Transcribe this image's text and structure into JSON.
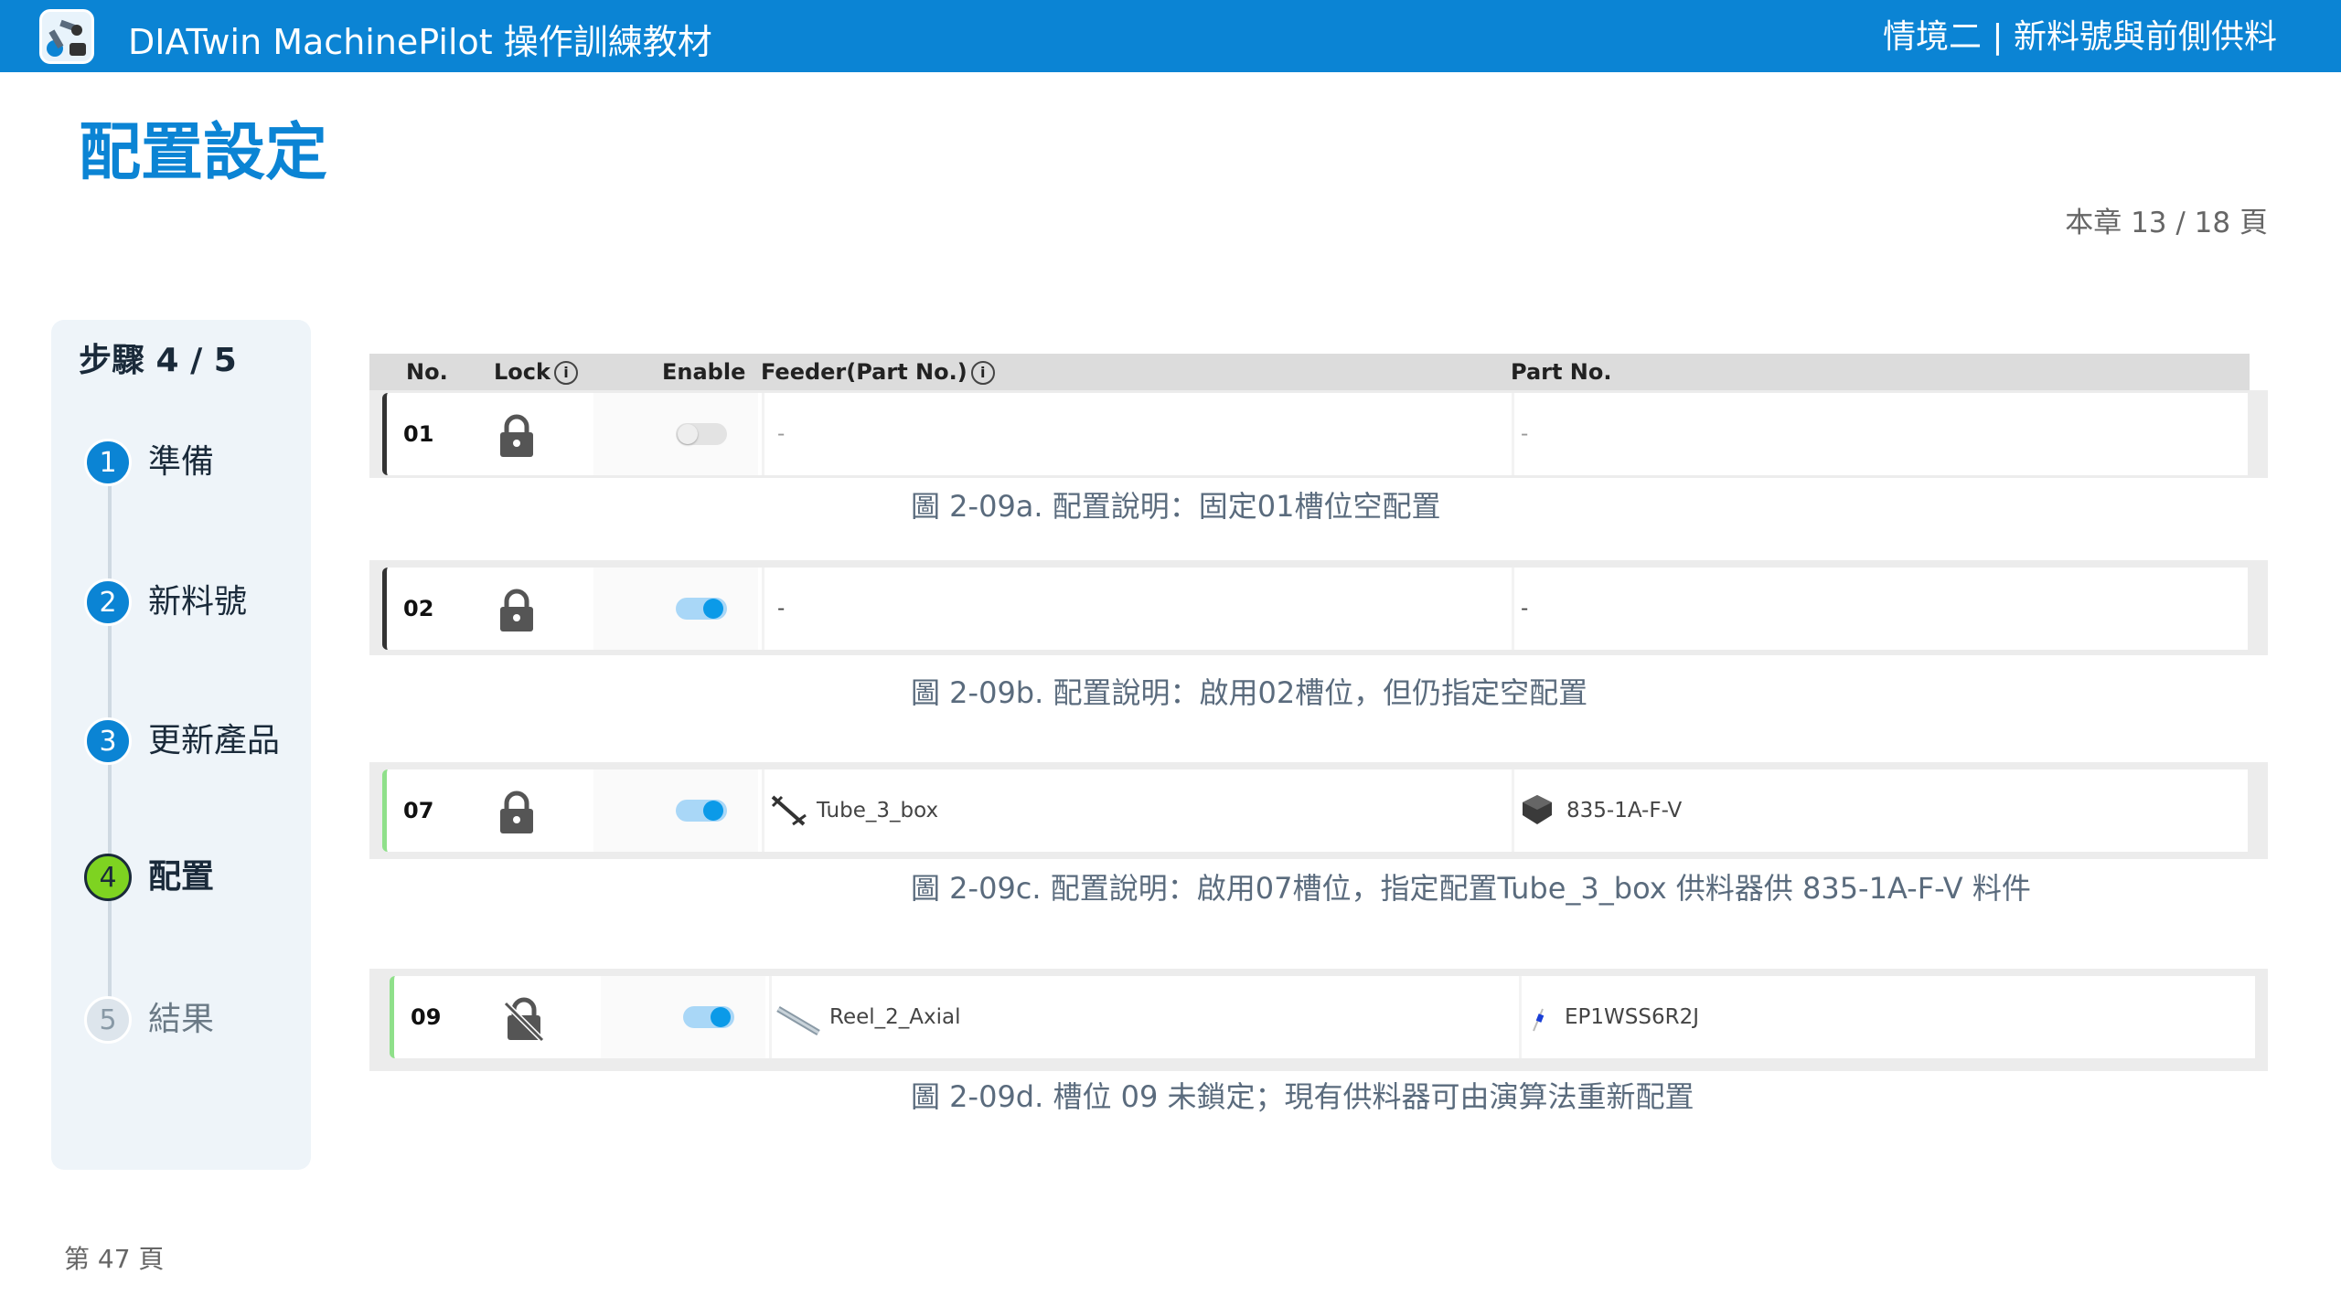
{
  "header": {
    "app_title": "DIATwin MachinePilot 操作訓練教材",
    "section_title": "情境二 | 新料號與前側供料",
    "logo_icon": "robot-arm-logo-icon"
  },
  "page_title": "配置設定",
  "chapter_page": "本章 13 / 18 頁",
  "steps": {
    "header": "步驟 4 / 5",
    "items": [
      {
        "number": "1",
        "label": "準備",
        "state": "done"
      },
      {
        "number": "2",
        "label": "新料號",
        "state": "done"
      },
      {
        "number": "3",
        "label": "更新產品",
        "state": "done"
      },
      {
        "number": "4",
        "label": "配置",
        "state": "active"
      },
      {
        "number": "5",
        "label": "結果",
        "state": "pending"
      }
    ]
  },
  "table": {
    "columns": {
      "no": "No.",
      "lock": "Lock",
      "enable": "Enable",
      "feeder": "Feeder(Part No.)",
      "part_no": "Part No."
    },
    "info_glyph": "i"
  },
  "figures": [
    {
      "no": "01",
      "lock": "locked",
      "enabled": false,
      "feeder": "-",
      "part_no": "-",
      "caption": "圖 2-09a. 配置說明：固定01槽位空配置"
    },
    {
      "no": "02",
      "lock": "locked",
      "enabled": true,
      "feeder": "-",
      "part_no": "-",
      "caption": "圖 2-09b. 配置說明：啟用02槽位，但仍指定空配置"
    },
    {
      "no": "07",
      "lock": "locked",
      "enabled": true,
      "feeder": "Tube_3_box",
      "part_no": "835-1A-F-V",
      "caption": "圖 2-09c. 配置說明：啟用07槽位，指定配置Tube_3_box 供料器供 835-1A-F-V 料件"
    },
    {
      "no": "09",
      "lock": "unlocked",
      "enabled": true,
      "feeder": "Reel_2_Axial",
      "part_no": "EP1WSS6R2J",
      "caption": "圖 2-09d. 槽位 09 未鎖定；現有供料器可由演算法重新配置"
    }
  ],
  "footer_page": "第 47 頁",
  "colors": {
    "brand_blue": "#0b84d4",
    "active_step_green": "#7ed321",
    "toggle_on": "#0b9ae8",
    "caption_text": "#5a6b7d"
  }
}
